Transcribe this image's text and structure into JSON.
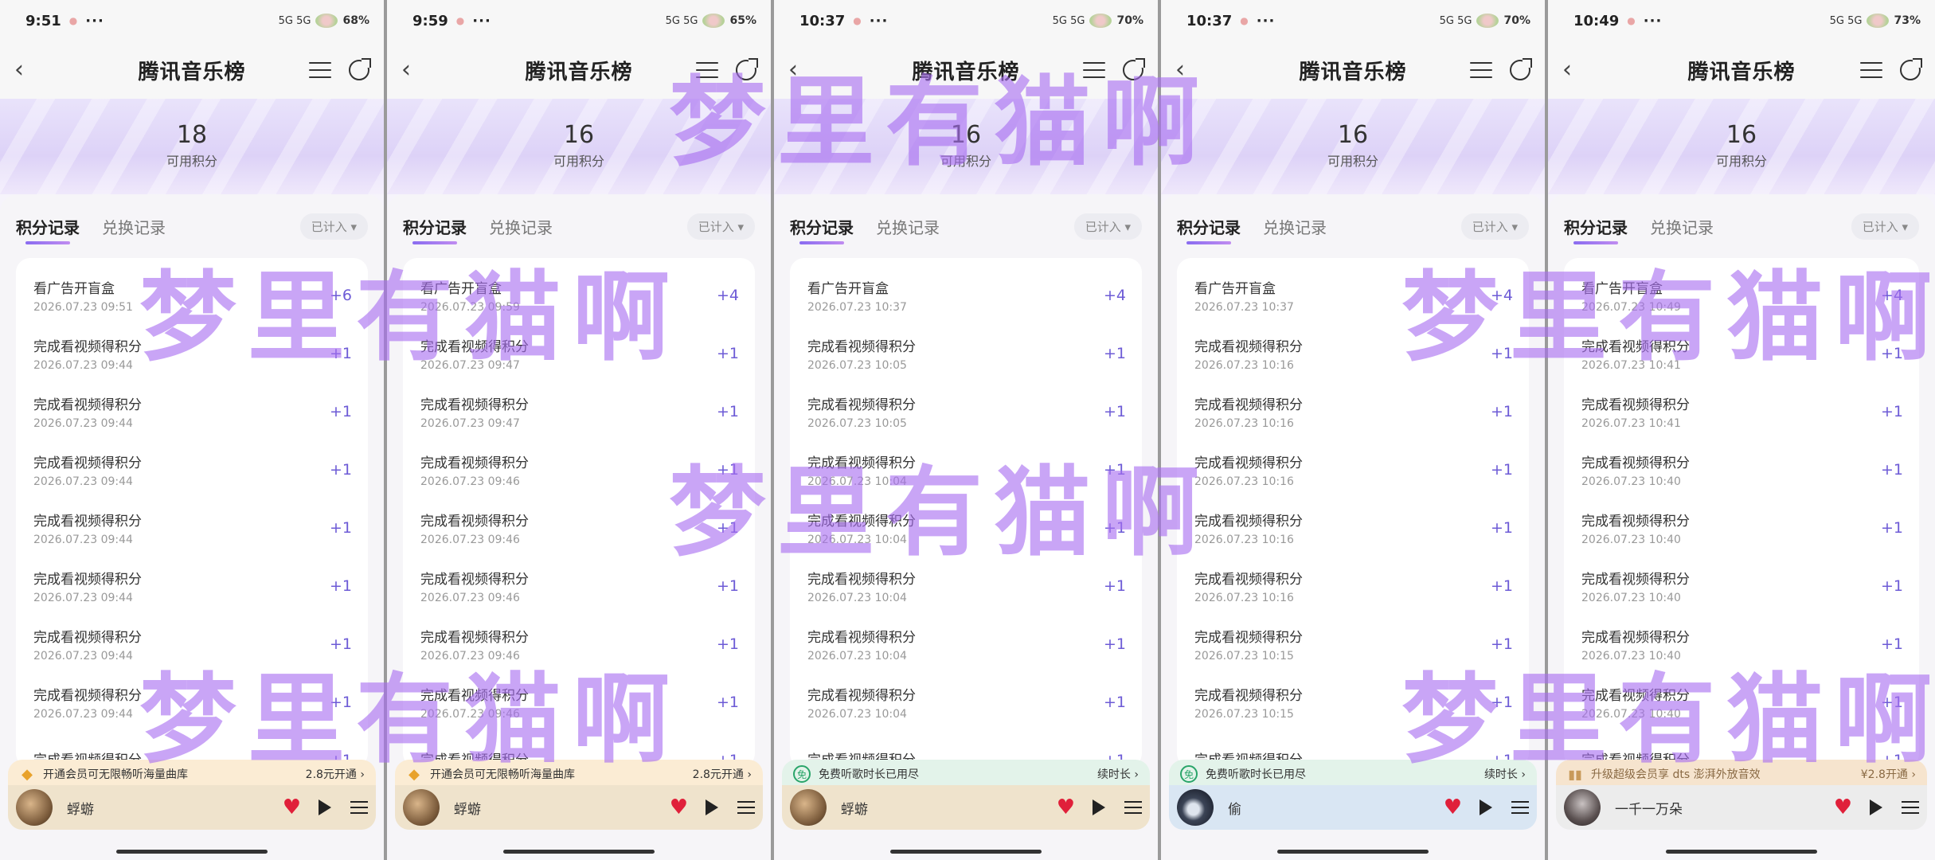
{
  "app": {
    "title": "腾讯音乐榜",
    "points_label": "可用积分",
    "tabs": [
      "积分记录",
      "兑换记录"
    ],
    "filter_label": "已计入 ▾"
  },
  "watermark_text": "梦里有猫啊",
  "colors": {
    "accent": "#6d5bd6",
    "watermark": "#a86ef0",
    "heart": "#e0203a",
    "banner": "#ddd2f7"
  },
  "phones": [
    {
      "time": "9:51",
      "signal": "5G 5G",
      "battery": "68%",
      "points": "18",
      "records": [
        {
          "title": "看广告开盲盒",
          "date": "2026.07.23 09:51",
          "pts": "+6"
        },
        {
          "title": "完成看视频得积分",
          "date": "2026.07.23 09:44",
          "pts": "+1"
        },
        {
          "title": "完成看视频得积分",
          "date": "2026.07.23 09:44",
          "pts": "+1"
        },
        {
          "title": "完成看视频得积分",
          "date": "2026.07.23 09:44",
          "pts": "+1"
        },
        {
          "title": "完成看视频得积分",
          "date": "2026.07.23 09:44",
          "pts": "+1"
        },
        {
          "title": "完成看视频得积分",
          "date": "2026.07.23 09:44",
          "pts": "+1"
        },
        {
          "title": "完成看视频得积分",
          "date": "2026.07.23 09:44",
          "pts": "+1"
        },
        {
          "title": "完成看视频得积分",
          "date": "2026.07.23 09:44",
          "pts": "+1"
        },
        {
          "title": "完成看视频得积分",
          "date": "",
          "pts": "+1"
        }
      ],
      "promo": {
        "type": "vip",
        "icon": "diamond-icon",
        "text": "开通会员可无限畅听海量曲库",
        "cta": "2.8元开通 ›"
      },
      "player": {
        "song": "蜉蝣",
        "cover": "warm"
      }
    },
    {
      "time": "9:59",
      "signal": "5G 5G",
      "battery": "65%",
      "points": "16",
      "records": [
        {
          "title": "看广告开盲盒",
          "date": "2026.07.23 09:59",
          "pts": "+4"
        },
        {
          "title": "完成看视频得积分",
          "date": "2026.07.23 09:47",
          "pts": "+1"
        },
        {
          "title": "完成看视频得积分",
          "date": "2026.07.23 09:47",
          "pts": "+1"
        },
        {
          "title": "完成看视频得积分",
          "date": "2026.07.23 09:46",
          "pts": "+1"
        },
        {
          "title": "完成看视频得积分",
          "date": "2026.07.23 09:46",
          "pts": "+1"
        },
        {
          "title": "完成看视频得积分",
          "date": "2026.07.23 09:46",
          "pts": "+1"
        },
        {
          "title": "完成看视频得积分",
          "date": "2026.07.23 09:46",
          "pts": "+1"
        },
        {
          "title": "完成看视频得积分",
          "date": "2026.07.23 09:46",
          "pts": "+1"
        },
        {
          "title": "完成看视频得积分",
          "date": "",
          "pts": "+1"
        }
      ],
      "promo": {
        "type": "vip",
        "icon": "diamond-icon",
        "text": "开通会员可无限畅听海量曲库",
        "cta": "2.8元开通 ›"
      },
      "player": {
        "song": "蜉蝣",
        "cover": "warm"
      }
    },
    {
      "time": "10:37",
      "signal": "5G 5G",
      "battery": "70%",
      "points": "16",
      "records": [
        {
          "title": "看广告开盲盒",
          "date": "2026.07.23 10:37",
          "pts": "+4"
        },
        {
          "title": "完成看视频得积分",
          "date": "2026.07.23 10:05",
          "pts": "+1"
        },
        {
          "title": "完成看视频得积分",
          "date": "2026.07.23 10:05",
          "pts": "+1"
        },
        {
          "title": "完成看视频得积分",
          "date": "2026.07.23 10:04",
          "pts": "+1"
        },
        {
          "title": "完成看视频得积分",
          "date": "2026.07.23 10:04",
          "pts": "+1"
        },
        {
          "title": "完成看视频得积分",
          "date": "2026.07.23 10:04",
          "pts": "+1"
        },
        {
          "title": "完成看视频得积分",
          "date": "2026.07.23 10:04",
          "pts": "+1"
        },
        {
          "title": "完成看视频得积分",
          "date": "2026.07.23 10:04",
          "pts": "+1"
        },
        {
          "title": "完成看视频得积分",
          "date": "",
          "pts": "+1"
        }
      ],
      "promo": {
        "type": "free",
        "icon": "free-icon",
        "text": "免费听歌时长已用尽",
        "cta": "续时长 ›"
      },
      "player": {
        "song": "蜉蝣",
        "cover": "warm"
      }
    },
    {
      "time": "10:37",
      "signal": "5G 5G",
      "battery": "70%",
      "points": "16",
      "records": [
        {
          "title": "看广告开盲盒",
          "date": "2026.07.23 10:37",
          "pts": "+4"
        },
        {
          "title": "完成看视频得积分",
          "date": "2026.07.23 10:16",
          "pts": "+1"
        },
        {
          "title": "完成看视频得积分",
          "date": "2026.07.23 10:16",
          "pts": "+1"
        },
        {
          "title": "完成看视频得积分",
          "date": "2026.07.23 10:16",
          "pts": "+1"
        },
        {
          "title": "完成看视频得积分",
          "date": "2026.07.23 10:16",
          "pts": "+1"
        },
        {
          "title": "完成看视频得积分",
          "date": "2026.07.23 10:16",
          "pts": "+1"
        },
        {
          "title": "完成看视频得积分",
          "date": "2026.07.23 10:15",
          "pts": "+1"
        },
        {
          "title": "完成看视频得积分",
          "date": "2026.07.23 10:15",
          "pts": "+1"
        },
        {
          "title": "完成看视频得积分",
          "date": "",
          "pts": "+1"
        }
      ],
      "promo": {
        "type": "free",
        "icon": "free-icon",
        "text": "免费听歌时长已用尽",
        "cta": "续时长 ›"
      },
      "player": {
        "song": "偷",
        "cover": "night"
      }
    },
    {
      "time": "10:49",
      "signal": "5G 5G",
      "battery": "73%",
      "points": "16",
      "records": [
        {
          "title": "看广告开盲盒",
          "date": "2026.07.23 10:49",
          "pts": "+4"
        },
        {
          "title": "完成看视频得积分",
          "date": "2026.07.23 10:41",
          "pts": "+1"
        },
        {
          "title": "完成看视频得积分",
          "date": "2026.07.23 10:41",
          "pts": "+1"
        },
        {
          "title": "完成看视频得积分",
          "date": "2026.07.23 10:40",
          "pts": "+1"
        },
        {
          "title": "完成看视频得积分",
          "date": "2026.07.23 10:40",
          "pts": "+1"
        },
        {
          "title": "完成看视频得积分",
          "date": "2026.07.23 10:40",
          "pts": "+1"
        },
        {
          "title": "完成看视频得积分",
          "date": "2026.07.23 10:40",
          "pts": "+1"
        },
        {
          "title": "完成看视频得积分",
          "date": "2026.07.23 10:40",
          "pts": "+1"
        },
        {
          "title": "完成看视频得积分",
          "date": "",
          "pts": "+1"
        }
      ],
      "promo": {
        "type": "dts",
        "icon": "equalizer-icon",
        "text": "升级超级会员享 dts 澎湃外放音效",
        "cta": "¥2.8开通 ›"
      },
      "player": {
        "song": "一千一万朵",
        "cover": "portrait"
      }
    }
  ]
}
